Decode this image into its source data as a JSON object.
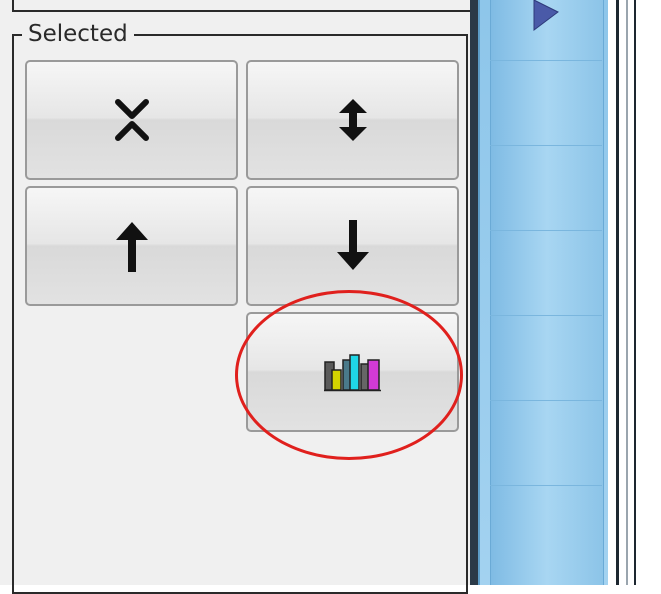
{
  "group": {
    "legend": "Selected"
  },
  "buttons": [
    {
      "id": "collapse",
      "icon": "collapse-arrows-icon"
    },
    {
      "id": "expand",
      "icon": "expand-arrows-icon"
    },
    {
      "id": "move_up",
      "icon": "arrow-up-icon"
    },
    {
      "id": "move_down",
      "icon": "arrow-down-icon"
    },
    {
      "id": "chart",
      "icon": "bar-chart-icon"
    }
  ],
  "annotation": {
    "shape": "ellipse",
    "color": "#e0201d",
    "target": "chart"
  },
  "colors": {
    "panel_bg": "#f0f0f0",
    "right_panel": "#9fd0f0",
    "chart_bars": [
      "#d4d400",
      "#1fd6e6",
      "#d23ad6"
    ]
  }
}
